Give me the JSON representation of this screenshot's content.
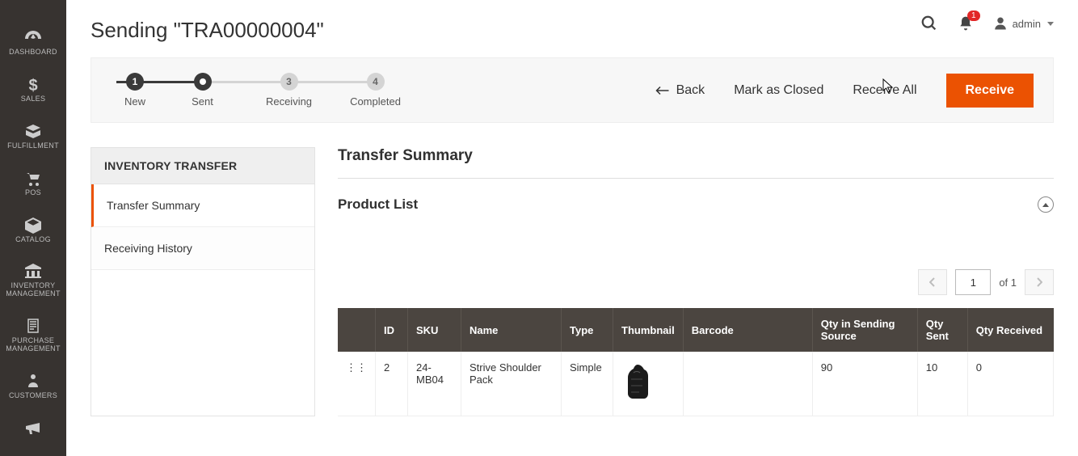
{
  "sidebar": {
    "items": [
      {
        "label": "DASHBOARD"
      },
      {
        "label": "SALES"
      },
      {
        "label": "FULFILLMENT"
      },
      {
        "label": "POS"
      },
      {
        "label": "CATALOG"
      },
      {
        "label": "INVENTORY\nMANAGEMENT"
      },
      {
        "label": "PURCHASE\nMANAGEMENT"
      },
      {
        "label": "CUSTOMERS"
      }
    ]
  },
  "header": {
    "title": "Sending \"TRA00000004\"",
    "notification_count": "1",
    "admin_label": "admin"
  },
  "progress": {
    "steps": [
      {
        "num": "1",
        "label": "New"
      },
      {
        "num": "",
        "label": "Sent"
      },
      {
        "num": "3",
        "label": "Receiving"
      },
      {
        "num": "4",
        "label": "Completed"
      }
    ]
  },
  "actions": {
    "back": "Back",
    "mark_closed": "Mark as Closed",
    "receive_all": "Receive All",
    "receive": "Receive"
  },
  "left_panel": {
    "heading": "INVENTORY TRANSFER",
    "items": [
      {
        "label": "Transfer Summary"
      },
      {
        "label": "Receiving History"
      }
    ]
  },
  "section": {
    "title": "Transfer Summary",
    "subtitle": "Product List"
  },
  "pager": {
    "page": "1",
    "of_label": "of 1"
  },
  "table": {
    "headers": {
      "id": "ID",
      "sku": "SKU",
      "name": "Name",
      "type": "Type",
      "thumbnail": "Thumbnail",
      "barcode": "Barcode",
      "qty_src": "Qty in Sending Source",
      "qty_sent": "Qty Sent",
      "qty_recv": "Qty Received"
    },
    "rows": [
      {
        "id": "2",
        "sku": "24-MB04",
        "name": "Strive Shoulder Pack",
        "type": "Simple",
        "barcode": "",
        "qty_src": "90",
        "qty_sent": "10",
        "qty_recv": "0"
      }
    ]
  }
}
